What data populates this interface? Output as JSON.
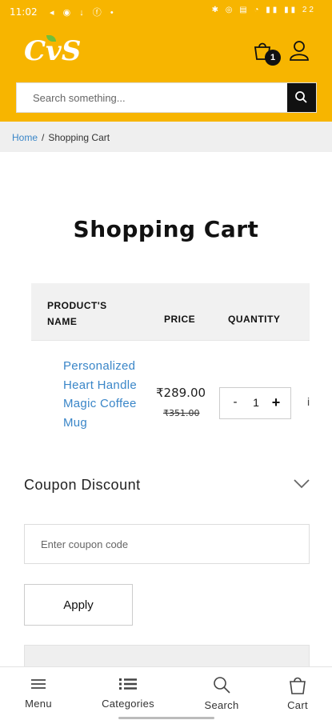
{
  "status_bar": {
    "time": "11:02",
    "battery": "22"
  },
  "header": {
    "logo_text": "CvS",
    "cart_count": "1"
  },
  "search": {
    "placeholder": "Search something..."
  },
  "breadcrumb": {
    "home": "Home",
    "separator": "/",
    "current": "Shopping Cart"
  },
  "page": {
    "title": "Shopping Cart"
  },
  "table": {
    "headers": {
      "product": "PRODUCT'S NAME",
      "price": "PRICE",
      "quantity": "QUANTITY"
    },
    "rows": [
      {
        "name": "Personalized Heart Handle Magic Coffee Mug",
        "price": "₹289.00",
        "old_price": "₹351.00",
        "quantity": "1"
      }
    ]
  },
  "coupon": {
    "title": "Coupon Discount",
    "placeholder": "Enter coupon code",
    "apply_label": "Apply"
  },
  "bottom_nav": {
    "menu": "Menu",
    "categories": "Categories",
    "search": "Search",
    "cart": "Cart"
  },
  "colors": {
    "brand": "#f7b500",
    "link": "#3a86c8"
  }
}
